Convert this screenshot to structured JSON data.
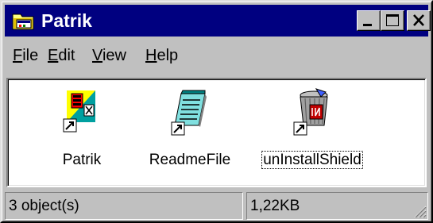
{
  "window": {
    "title": "Patrik",
    "icon": "folder-icon",
    "title_bar_color": "#000080",
    "controls": [
      "minimize-icon",
      "maximize-icon",
      "close-icon"
    ]
  },
  "menu": [
    {
      "label": "File",
      "underline": "F"
    },
    {
      "label": "Edit",
      "underline": "E"
    },
    {
      "label": "View",
      "underline": "V"
    },
    {
      "label": "Help",
      "underline": "H"
    }
  ],
  "items": [
    {
      "label": "Patrik",
      "icon": "program-shortcut-icon",
      "shortcut": true,
      "selected": false
    },
    {
      "label": "ReadmeFile",
      "icon": "notepad-document-shortcut-icon",
      "shortcut": true,
      "selected": false
    },
    {
      "label": "unInstallShield",
      "icon": "uninstall-trash-shortcut-icon",
      "shortcut": true,
      "selected": true
    }
  ],
  "status": {
    "objects": "3 object(s)",
    "size": "1,22KB"
  }
}
